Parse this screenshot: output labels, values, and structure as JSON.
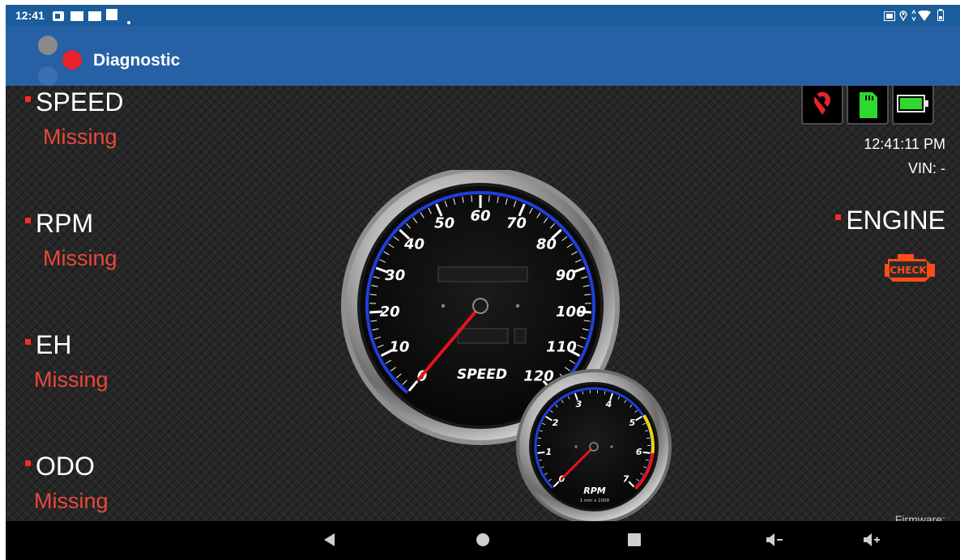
{
  "status_bar": {
    "time": "12:41"
  },
  "app_bar": {
    "title": "Diagnostic"
  },
  "metrics": [
    {
      "label": "SPEED",
      "value": "Missing"
    },
    {
      "label": "RPM",
      "value": "Missing"
    },
    {
      "label": "EH",
      "value": "Missing"
    },
    {
      "label": "ODO",
      "value": "Missing"
    }
  ],
  "right_panel": {
    "clock": "12:41:11 PM",
    "vin": "VIN: -",
    "engine_label": "ENGINE",
    "check_text": "CHECK",
    "firmware_label": "Firmware:"
  },
  "speed_gauge": {
    "label": "SPEED",
    "ticks": [
      "0",
      "10",
      "20",
      "30",
      "40",
      "50",
      "60",
      "70",
      "80",
      "90",
      "100",
      "110",
      "120"
    ],
    "needle_value": 0
  },
  "rpm_gauge": {
    "label": "RPM",
    "unit": "1 min x 1000",
    "ticks": [
      "0",
      "1",
      "2",
      "3",
      "4",
      "5",
      "6",
      "7"
    ],
    "needle_value": 0
  },
  "colors": {
    "accent_red": "#e8483c",
    "app_bar": "#2661a5",
    "status_bar": "#1a5d9a",
    "gauge_ring": "#1f3fd8",
    "check_engine": "#ff4a1a"
  },
  "icons": [
    "gps-off-icon",
    "sd-card-icon",
    "battery-icon",
    "check-engine-icon",
    "back-icon",
    "home-icon",
    "recents-icon",
    "volume-down-icon",
    "volume-up-icon"
  ]
}
